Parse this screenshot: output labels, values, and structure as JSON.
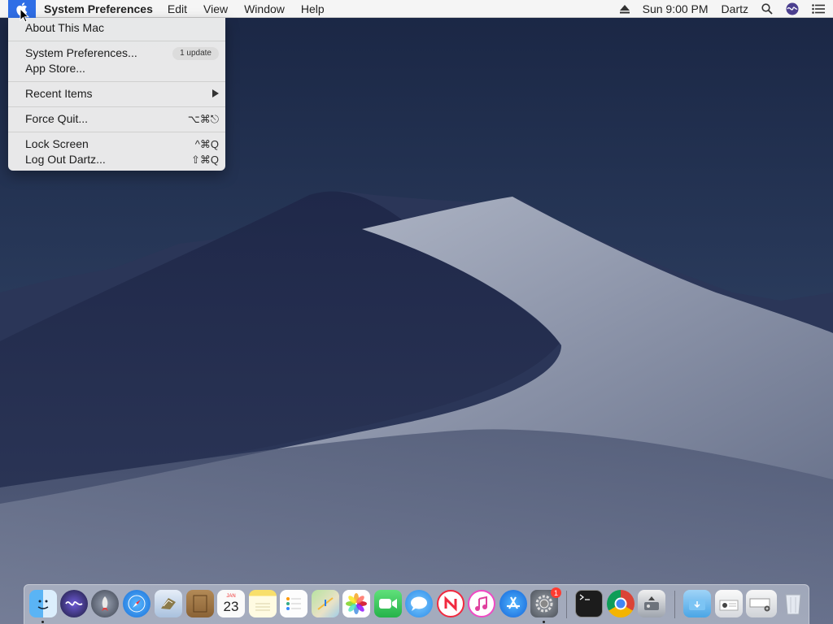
{
  "menubar": {
    "app_name": "System Preferences",
    "menus": [
      "Edit",
      "View",
      "Window",
      "Help"
    ],
    "clock": "Sun 9:00 PM",
    "user": "Dartz"
  },
  "apple_menu": {
    "about": "About This Mac",
    "system_preferences": "System Preferences...",
    "update_badge": "1 update",
    "app_store": "App Store...",
    "recent_items": "Recent Items",
    "force_quit": "Force Quit...",
    "force_quit_shortcut": "⌥⌘⎋",
    "lock_screen": "Lock Screen",
    "lock_screen_shortcut": "^⌘Q",
    "log_out": "Log Out Dartz...",
    "log_out_shortcut": "⇧⌘Q"
  },
  "dock": {
    "calendar_month": "JAN",
    "calendar_day": "23",
    "sysprefs_badge": "1",
    "apps": [
      "finder-icon",
      "siri-icon",
      "launchpad-icon",
      "safari-icon",
      "mail-icon",
      "contacts-icon",
      "calendar-icon",
      "notes-icon",
      "reminders-icon",
      "maps-icon",
      "photos-icon",
      "facetime-icon",
      "messages-icon",
      "news-icon",
      "itunes-icon",
      "app-store-icon",
      "system-preferences-icon",
      "terminal-icon",
      "chrome-icon",
      "disk-utility-icon",
      "downloads-stack-icon",
      "documents-stack-icon",
      "screenshots-stack-icon",
      "trash-icon"
    ]
  },
  "colors": {
    "menu_highlight": "#2f6ee6",
    "sky": "#1f2c4a",
    "dune_light": "#9aa3b8",
    "dune_shadow": "#1c2440"
  }
}
